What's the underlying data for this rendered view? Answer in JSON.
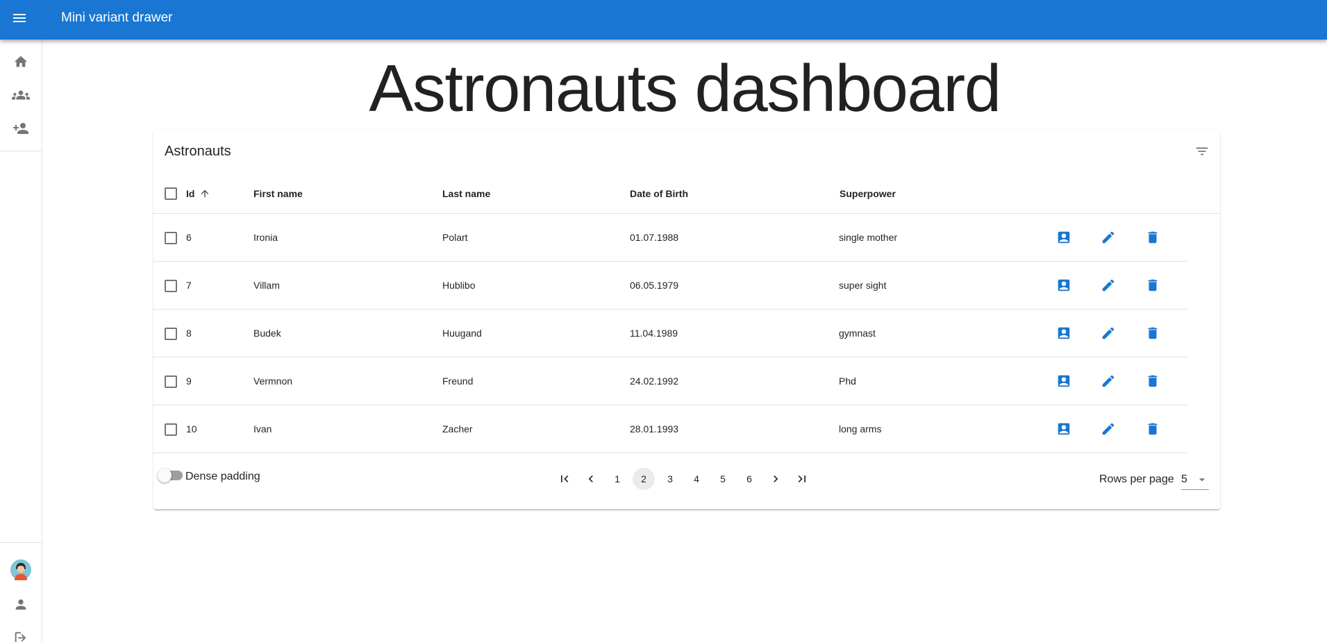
{
  "appbar": {
    "title": "Mini variant drawer"
  },
  "drawer": {
    "top_items": [
      {
        "icon": "home-icon"
      },
      {
        "icon": "group-icon"
      },
      {
        "icon": "person-add-icon"
      }
    ],
    "bottom_items": [
      {
        "icon": "avatar"
      },
      {
        "icon": "person-icon"
      },
      {
        "icon": "logout-icon"
      }
    ]
  },
  "page": {
    "title": "Astronauts dashboard"
  },
  "table": {
    "title": "Astronauts",
    "headers": {
      "id": "Id",
      "first_name": "First name",
      "last_name": "Last name",
      "dob": "Date of Birth",
      "superpower": "Superpower"
    },
    "sort": {
      "column": "id",
      "direction": "asc"
    },
    "rows": [
      {
        "id": "6",
        "first_name": "Ironia",
        "last_name": "Polart",
        "dob": "01.07.1988",
        "superpower": "single mother"
      },
      {
        "id": "7",
        "first_name": "Villam",
        "last_name": "Hublibo",
        "dob": "06.05.1979",
        "superpower": "super sight"
      },
      {
        "id": "8",
        "first_name": "Budek",
        "last_name": "Huugand",
        "dob": "11.04.1989",
        "superpower": "gymnast"
      },
      {
        "id": "9",
        "first_name": "Vermnon",
        "last_name": "Freund",
        "dob": "24.02.1992",
        "superpower": "Phd"
      },
      {
        "id": "10",
        "first_name": "Ivan",
        "last_name": "Zacher",
        "dob": "28.01.1993",
        "superpower": "long arms"
      }
    ],
    "row_actions": [
      "profile-icon",
      "edit-icon",
      "delete-icon"
    ]
  },
  "footer": {
    "dense_label": "Dense padding",
    "dense_checked": false,
    "pages": [
      "1",
      "2",
      "3",
      "4",
      "5",
      "6"
    ],
    "current_page": "2",
    "rows_per_page_label": "Rows per page",
    "rows_per_page_value": "5"
  },
  "colors": {
    "primary": "#1976d2"
  }
}
